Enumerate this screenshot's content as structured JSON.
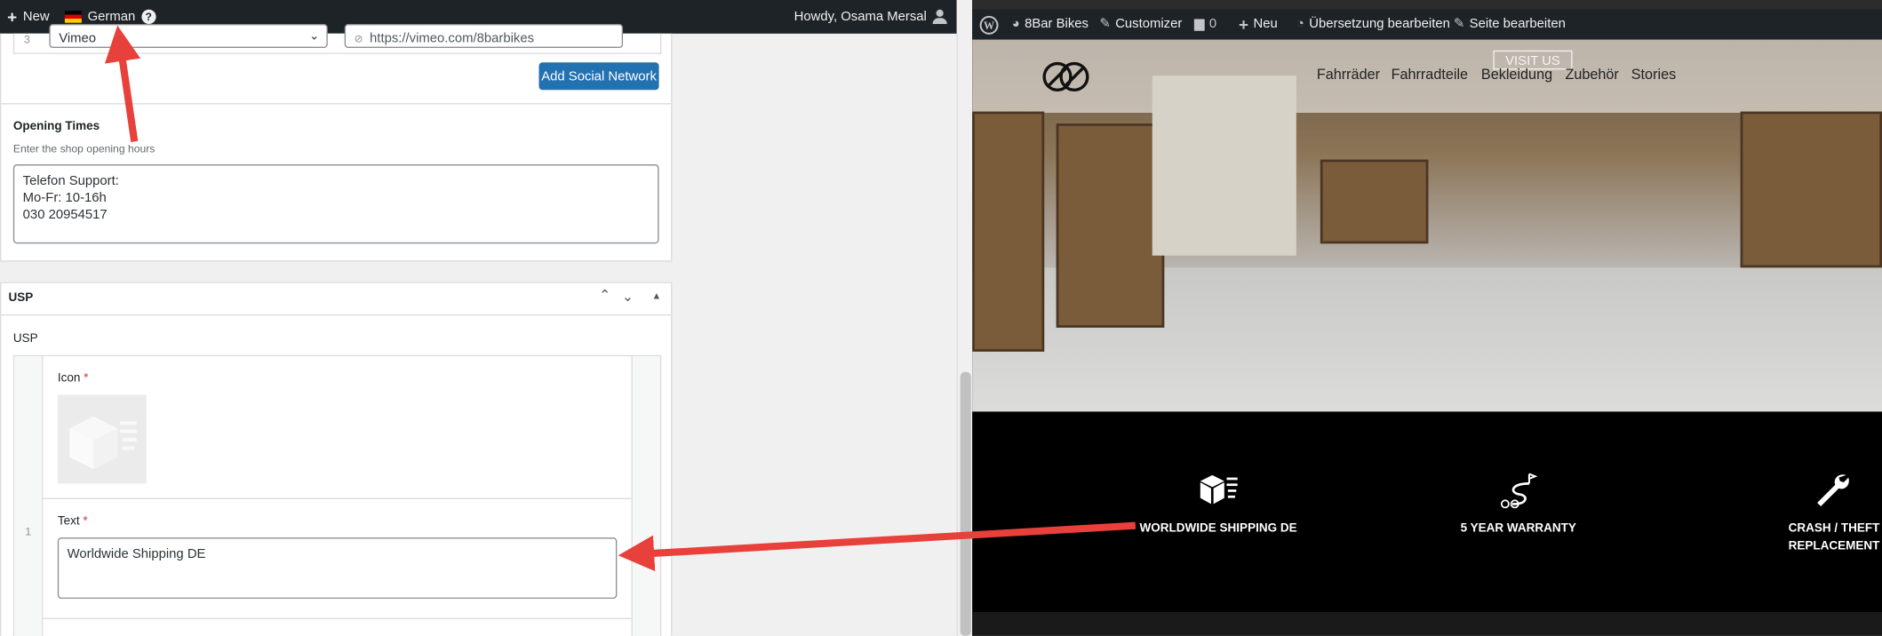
{
  "admin_bar_left": {
    "new_label": "New",
    "language_label": "German",
    "help_glyph": "?",
    "greeting": "Howdy, Osama Mersal"
  },
  "social": {
    "row_index": "3",
    "network_value": "Vimeo",
    "url_value": "https://vimeo.com/8barbikes",
    "add_button_label": "Add Social Network"
  },
  "opening_times": {
    "label": "Opening Times",
    "description": "Enter the shop opening hours",
    "value": "Telefon Support:\nMo-Fr: 10-16h\n030 20954517"
  },
  "usp_section": {
    "title": "USP",
    "field_label": "USP",
    "row_index": "1",
    "icon_label": "Icon",
    "text_label": "Text",
    "text_value": "Worldwide Shipping DE",
    "required_mark": "*"
  },
  "admin_bar_right": {
    "site_name": "8Bar Bikes",
    "customizer_label": "Customizer",
    "comments_count": "0",
    "new_label": "Neu",
    "translate_label": "Übersetzung bearbeiten",
    "edit_page_label": "Seite bearbeiten"
  },
  "site_nav": {
    "items": [
      "Fahrräder",
      "Fahrradteile",
      "Bekleidung",
      "Zubehör",
      "Stories"
    ],
    "visit_label": "VISIT US"
  },
  "usp_preview": {
    "items": [
      {
        "icon": "box-shipping-icon",
        "label": "WORLDWIDE SHIPPING DE"
      },
      {
        "icon": "bike-route-icon",
        "label": "5 YEAR WARRANTY"
      },
      {
        "icon": "wrench-icon",
        "label": "CRASH / THEFT REPLACEMENT"
      }
    ]
  },
  "colors": {
    "admin_bar": "#1d2327",
    "wp_blue": "#2271b1",
    "annotation_arrow": "#e8403a",
    "preview_bg": "#000000"
  }
}
